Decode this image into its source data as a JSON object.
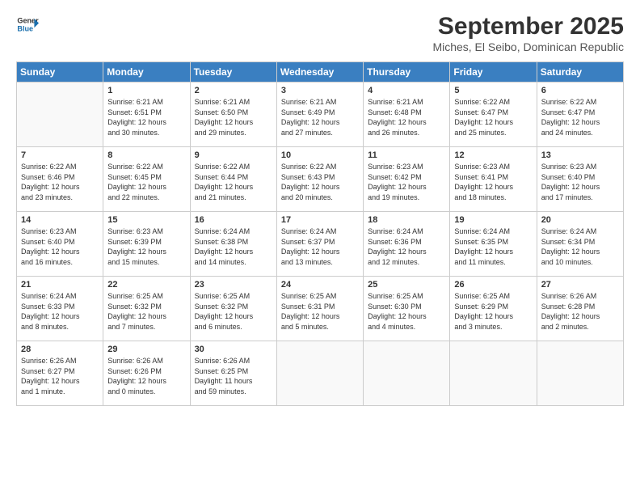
{
  "logo": {
    "line1": "General",
    "line2": "Blue"
  },
  "title": "September 2025",
  "subtitle": "Miches, El Seibo, Dominican Republic",
  "days_header": [
    "Sunday",
    "Monday",
    "Tuesday",
    "Wednesday",
    "Thursday",
    "Friday",
    "Saturday"
  ],
  "weeks": [
    [
      {
        "num": "",
        "info": ""
      },
      {
        "num": "1",
        "info": "Sunrise: 6:21 AM\nSunset: 6:51 PM\nDaylight: 12 hours\nand 30 minutes."
      },
      {
        "num": "2",
        "info": "Sunrise: 6:21 AM\nSunset: 6:50 PM\nDaylight: 12 hours\nand 29 minutes."
      },
      {
        "num": "3",
        "info": "Sunrise: 6:21 AM\nSunset: 6:49 PM\nDaylight: 12 hours\nand 27 minutes."
      },
      {
        "num": "4",
        "info": "Sunrise: 6:21 AM\nSunset: 6:48 PM\nDaylight: 12 hours\nand 26 minutes."
      },
      {
        "num": "5",
        "info": "Sunrise: 6:22 AM\nSunset: 6:47 PM\nDaylight: 12 hours\nand 25 minutes."
      },
      {
        "num": "6",
        "info": "Sunrise: 6:22 AM\nSunset: 6:47 PM\nDaylight: 12 hours\nand 24 minutes."
      }
    ],
    [
      {
        "num": "7",
        "info": "Sunrise: 6:22 AM\nSunset: 6:46 PM\nDaylight: 12 hours\nand 23 minutes."
      },
      {
        "num": "8",
        "info": "Sunrise: 6:22 AM\nSunset: 6:45 PM\nDaylight: 12 hours\nand 22 minutes."
      },
      {
        "num": "9",
        "info": "Sunrise: 6:22 AM\nSunset: 6:44 PM\nDaylight: 12 hours\nand 21 minutes."
      },
      {
        "num": "10",
        "info": "Sunrise: 6:22 AM\nSunset: 6:43 PM\nDaylight: 12 hours\nand 20 minutes."
      },
      {
        "num": "11",
        "info": "Sunrise: 6:23 AM\nSunset: 6:42 PM\nDaylight: 12 hours\nand 19 minutes."
      },
      {
        "num": "12",
        "info": "Sunrise: 6:23 AM\nSunset: 6:41 PM\nDaylight: 12 hours\nand 18 minutes."
      },
      {
        "num": "13",
        "info": "Sunrise: 6:23 AM\nSunset: 6:40 PM\nDaylight: 12 hours\nand 17 minutes."
      }
    ],
    [
      {
        "num": "14",
        "info": "Sunrise: 6:23 AM\nSunset: 6:40 PM\nDaylight: 12 hours\nand 16 minutes."
      },
      {
        "num": "15",
        "info": "Sunrise: 6:23 AM\nSunset: 6:39 PM\nDaylight: 12 hours\nand 15 minutes."
      },
      {
        "num": "16",
        "info": "Sunrise: 6:24 AM\nSunset: 6:38 PM\nDaylight: 12 hours\nand 14 minutes."
      },
      {
        "num": "17",
        "info": "Sunrise: 6:24 AM\nSunset: 6:37 PM\nDaylight: 12 hours\nand 13 minutes."
      },
      {
        "num": "18",
        "info": "Sunrise: 6:24 AM\nSunset: 6:36 PM\nDaylight: 12 hours\nand 12 minutes."
      },
      {
        "num": "19",
        "info": "Sunrise: 6:24 AM\nSunset: 6:35 PM\nDaylight: 12 hours\nand 11 minutes."
      },
      {
        "num": "20",
        "info": "Sunrise: 6:24 AM\nSunset: 6:34 PM\nDaylight: 12 hours\nand 10 minutes."
      }
    ],
    [
      {
        "num": "21",
        "info": "Sunrise: 6:24 AM\nSunset: 6:33 PM\nDaylight: 12 hours\nand 8 minutes."
      },
      {
        "num": "22",
        "info": "Sunrise: 6:25 AM\nSunset: 6:32 PM\nDaylight: 12 hours\nand 7 minutes."
      },
      {
        "num": "23",
        "info": "Sunrise: 6:25 AM\nSunset: 6:32 PM\nDaylight: 12 hours\nand 6 minutes."
      },
      {
        "num": "24",
        "info": "Sunrise: 6:25 AM\nSunset: 6:31 PM\nDaylight: 12 hours\nand 5 minutes."
      },
      {
        "num": "25",
        "info": "Sunrise: 6:25 AM\nSunset: 6:30 PM\nDaylight: 12 hours\nand 4 minutes."
      },
      {
        "num": "26",
        "info": "Sunrise: 6:25 AM\nSunset: 6:29 PM\nDaylight: 12 hours\nand 3 minutes."
      },
      {
        "num": "27",
        "info": "Sunrise: 6:26 AM\nSunset: 6:28 PM\nDaylight: 12 hours\nand 2 minutes."
      }
    ],
    [
      {
        "num": "28",
        "info": "Sunrise: 6:26 AM\nSunset: 6:27 PM\nDaylight: 12 hours\nand 1 minute."
      },
      {
        "num": "29",
        "info": "Sunrise: 6:26 AM\nSunset: 6:26 PM\nDaylight: 12 hours\nand 0 minutes."
      },
      {
        "num": "30",
        "info": "Sunrise: 6:26 AM\nSunset: 6:25 PM\nDaylight: 11 hours\nand 59 minutes."
      },
      {
        "num": "",
        "info": ""
      },
      {
        "num": "",
        "info": ""
      },
      {
        "num": "",
        "info": ""
      },
      {
        "num": "",
        "info": ""
      }
    ]
  ]
}
